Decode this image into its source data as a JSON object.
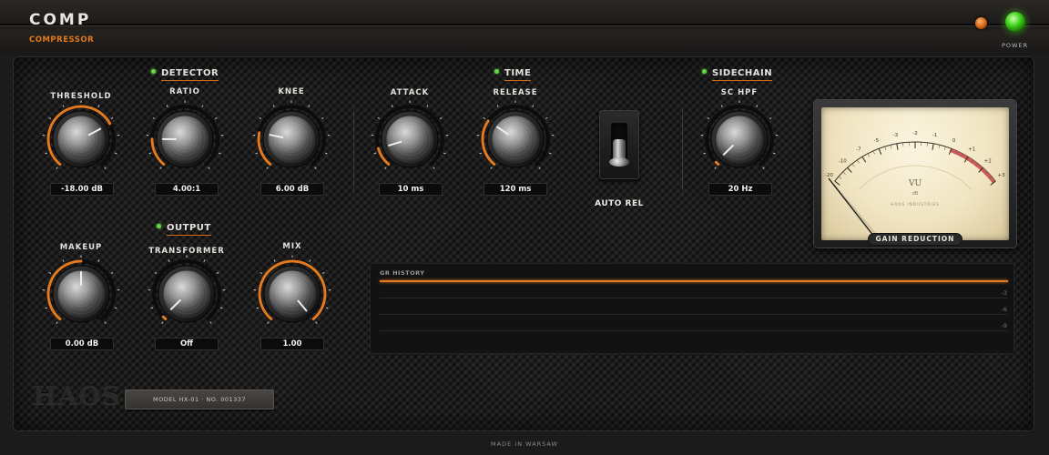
{
  "header": {
    "title": "COMP",
    "subtitle": "COMPRESSOR",
    "power_label": "POWER"
  },
  "sections": {
    "detector": "DETECTOR",
    "time": "TIME",
    "sidechain": "SIDECHAIN",
    "output": "OUTPUT"
  },
  "knobs": {
    "threshold": {
      "label": "THRESHOLD",
      "value": "-18.00 dB",
      "level": 0.72
    },
    "ratio": {
      "label": "RATIO",
      "value": "4.00:1",
      "level": 0.18
    },
    "knee": {
      "label": "KNEE",
      "value": "6.00 dB",
      "level": 0.22
    },
    "attack": {
      "label": "ATTACK",
      "value": "10 ms",
      "level": 0.12
    },
    "release": {
      "label": "RELEASE",
      "value": "120 ms",
      "level": 0.3
    },
    "sc_hpf": {
      "label": "SC HPF",
      "value": "20 Hz",
      "level": 0.02
    },
    "makeup": {
      "label": "MAKEUP",
      "value": "0.00 dB",
      "level": 0.5
    },
    "transformer": {
      "label": "TRANSFORMER",
      "value": "Off",
      "level": 0.02
    },
    "mix": {
      "label": "MIX",
      "value": "1.00",
      "level": 1.0
    }
  },
  "auto_release": {
    "label": "AUTO REL"
  },
  "vu_meter": {
    "scale": [
      "-20",
      "-10",
      "-7",
      "-5",
      "-3",
      "-2",
      "-1",
      "0",
      "+1",
      "+2",
      "+3"
    ],
    "unit": "VU",
    "sub": "dB",
    "brand": "HAOS INDUSTRIES",
    "badge": "GAIN REDUCTION"
  },
  "gr_history": {
    "title": "GR HISTORY",
    "ticks": [
      "-3",
      "-6",
      "-9"
    ]
  },
  "footer": {
    "logo": "HAOS",
    "plate": "MODEL HX-01  ·  NO. 001337",
    "made_in": "MADE IN WARSAW"
  },
  "colors": {
    "accent": "#e27a20",
    "led_green": "#67d649",
    "power_green": "#3fd21a"
  }
}
